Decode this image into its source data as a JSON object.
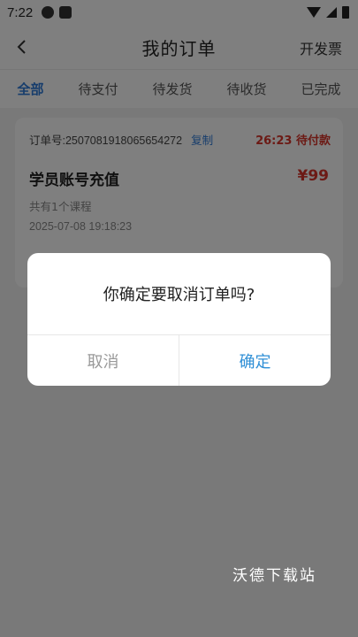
{
  "status_bar": {
    "time": "7:22"
  },
  "header": {
    "title": "我的订单",
    "action": "开发票"
  },
  "tabs": [
    {
      "label": "全部",
      "active": true
    },
    {
      "label": "待支付",
      "active": false
    },
    {
      "label": "待发货",
      "active": false
    },
    {
      "label": "待收货",
      "active": false
    },
    {
      "label": "已完成",
      "active": false
    }
  ],
  "order": {
    "number": "订单号:2507081918065654272",
    "copy_label": "复制",
    "status": "26:23 待付款",
    "product": "学员账号充值",
    "price": "¥99",
    "course_count": "共有1个课程",
    "time": "2025-07-08 19:18:23"
  },
  "dialog": {
    "message": "你确定要取消订单吗?",
    "cancel_label": "取消",
    "confirm_label": "确定"
  },
  "watermark": "沃德下载站",
  "colors": {
    "accent": "#2f7bd8",
    "price_red": "#d9342a",
    "overlay": "rgba(0,0,0,0.5)"
  }
}
